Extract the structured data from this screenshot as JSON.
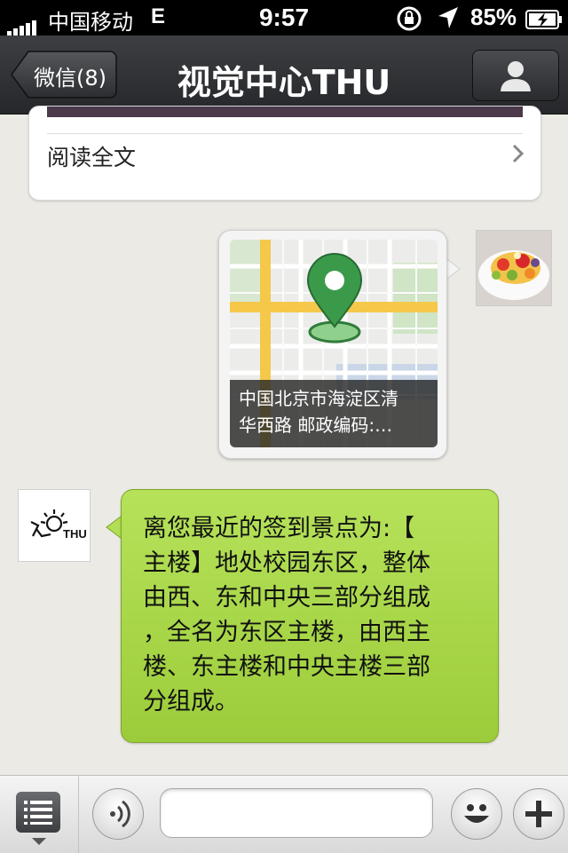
{
  "status_bar": {
    "carrier": "中国移动",
    "network": "E",
    "time": "9:57",
    "battery_percent": "85%",
    "icons": [
      "signal-icon",
      "rotation-lock-icon",
      "location-arrow-icon",
      "battery-charging-icon"
    ]
  },
  "nav": {
    "back_label": "微信(8)",
    "title": "视觉中心THU",
    "profile_icon": "person-icon"
  },
  "chat": {
    "article_card": {
      "read_more": "阅读全文"
    },
    "location_message": {
      "caption_line1": "中国北京市海淀区清",
      "caption_line2": "华西路 邮政编码:…"
    },
    "bot_message": {
      "lines": [
        "离您最近的签到景点为:【",
        "主楼】地处校园东区，整体",
        "由西、东和中央三部分组成",
        "，全名为东区主楼，由西主",
        "楼、东主楼和中央主楼三部",
        "分组成。"
      ]
    },
    "bot_avatar_text": "THU"
  },
  "toolbar": {
    "input_value": "",
    "icons": [
      "menu-list-icon",
      "voice-icon",
      "emoji-icon",
      "plus-icon"
    ]
  },
  "colors": {
    "bubble_green": "#a5d444",
    "nav_bg": "#2e3033",
    "pin_green": "#3a9a4a",
    "road_yellow": "#f5c84a"
  }
}
